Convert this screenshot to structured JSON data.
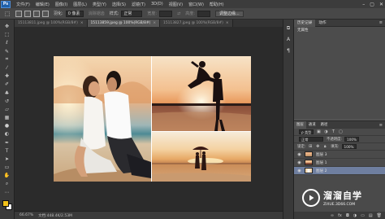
{
  "app": {
    "logo": "Ps"
  },
  "menu": [
    "文件(F)",
    "编辑(E)",
    "图像(I)",
    "图层(L)",
    "类型(Y)",
    "选择(S)",
    "滤镜(T)",
    "3D(D)",
    "视图(V)",
    "窗口(W)",
    "帮助(H)"
  ],
  "window_controls": [
    "–",
    "▢",
    "✕"
  ],
  "options": {
    "feather_label": "羽化:",
    "feather_value": "0 像素",
    "antialias_label": "消除锯齿",
    "style_label": "样式:",
    "style_value": "正常",
    "width_label": "宽度:",
    "height_label": "高度:",
    "refine_button": "调整边缘..."
  },
  "tabs": [
    {
      "label": "15113811.jpeg @ 100%(RGB/8#)",
      "active": false
    },
    {
      "label": "15113859.jpeg @ 100%(RGB/8#)",
      "active": true
    },
    {
      "label": "15113827.jpeg @ 100%(RGB/8#)",
      "active": false
    }
  ],
  "status": {
    "zoom": "66.67%",
    "doc": "文档:448.4K/2.53M"
  },
  "history_panel": {
    "tabs": [
      "历史记录",
      "动作"
    ],
    "rows": [
      "无属性"
    ]
  },
  "layers_panel": {
    "tabs": [
      "图层",
      "通道",
      "路径"
    ],
    "kind_label": "ρ 类型",
    "blend_mode": "正常",
    "opacity_label": "不透明度:",
    "opacity_value": "100%",
    "lock_label": "锁定:",
    "fill_label": "填充:",
    "fill_value": "100%",
    "layers": [
      {
        "name": "图层 3",
        "selected": false
      },
      {
        "name": "图层 1",
        "selected": false
      },
      {
        "name": "图层 2",
        "selected": true
      }
    ],
    "footer_icons": [
      "link-icon",
      "fx-icon",
      "mask-icon",
      "adjustment-icon",
      "folder-icon",
      "new-layer-icon",
      "trash-icon"
    ]
  },
  "watermark": {
    "title": "溜溜自学",
    "url": "ZIXUE.3D66.COM"
  },
  "colors": {
    "foreground": "#f2c21a",
    "background": "#ffffff",
    "selection": "#6f7fa0"
  }
}
